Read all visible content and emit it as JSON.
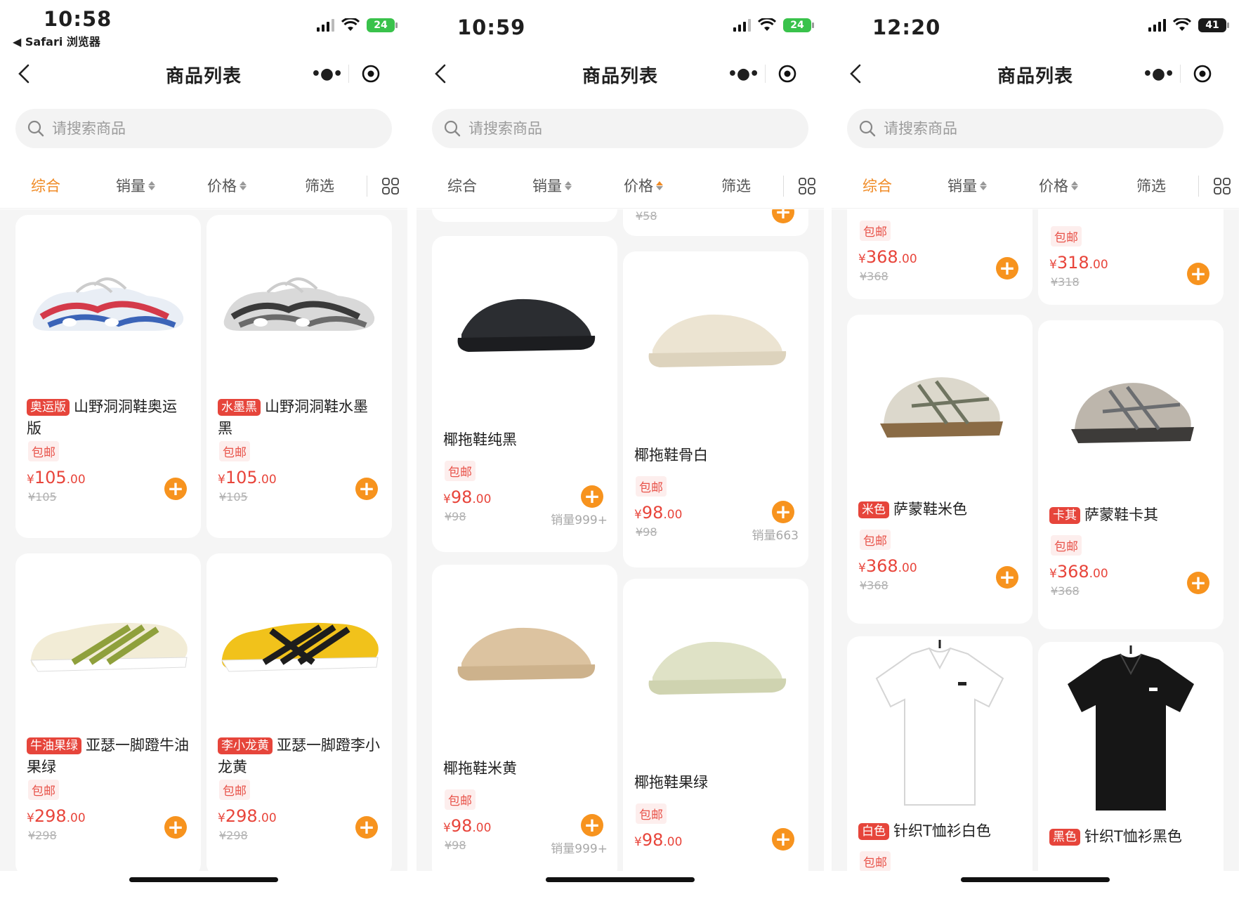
{
  "common": {
    "title": "商品列表",
    "search_placeholder": "请搜索商品",
    "tabs": {
      "overall": "综合",
      "sales": "销量",
      "price": "价格",
      "filter": "筛选"
    },
    "free_shipping": "包邮",
    "currency": "¥",
    "accent_color": "#f08a24",
    "price_color": "#e8453b",
    "tag_color": "#e6453b",
    "add_button_color": "#f7931e"
  },
  "screens": [
    {
      "status": {
        "time": "10:58",
        "back_app": "◀ Safari 浏览器",
        "battery": "24"
      },
      "active_tab": "overall",
      "products": [
        {
          "tag": "奥运版",
          "name": "山野洞洞鞋奥运版",
          "price_int": "105",
          "price_dec": ".00",
          "orig": "¥105",
          "icon": "clog-shoe-multicolor"
        },
        {
          "tag": "水墨黑",
          "name": "山野洞洞鞋水墨黑",
          "price_int": "105",
          "price_dec": ".00",
          "orig": "¥105",
          "icon": "clog-shoe-ink"
        },
        {
          "tag": "牛油果绿",
          "name": "亚瑟一脚蹬牛油果绿",
          "price_int": "298",
          "price_dec": ".00",
          "orig": "¥298",
          "icon": "sneaker-green"
        },
        {
          "tag": "李小龙黄",
          "name": "亚瑟一脚蹬李小龙黄",
          "price_int": "298",
          "price_dec": ".00",
          "orig": "¥298",
          "icon": "sneaker-yellow"
        }
      ]
    },
    {
      "status": {
        "time": "10:59",
        "battery": "24"
      },
      "active_tab": "price",
      "partial_top": {
        "orig": "¥58"
      },
      "products": [
        {
          "name": "椰拖鞋纯黑",
          "price_int": "98",
          "price_dec": ".00",
          "orig": "¥98",
          "sold": "销量999+",
          "icon": "slide-black"
        },
        {
          "name": "椰拖鞋骨白",
          "price_int": "98",
          "price_dec": ".00",
          "orig": "¥98",
          "sold": "销量663",
          "icon": "slide-bone"
        },
        {
          "name": "椰拖鞋米黄",
          "price_int": "98",
          "price_dec": ".00",
          "orig": "¥98",
          "sold": "销量999+",
          "icon": "slide-sand"
        },
        {
          "name": "椰拖鞋果绿",
          "price_int": "98",
          "price_dec": ".00",
          "orig": "¥98",
          "icon": "slide-green"
        }
      ]
    },
    {
      "status": {
        "time": "12:20",
        "battery": "41"
      },
      "active_tab": "overall",
      "partial_top": [
        {
          "price_int": "368",
          "price_dec": ".00",
          "orig": "¥368"
        },
        {
          "price_int": "318",
          "price_dec": ".00",
          "orig": "¥318"
        }
      ],
      "products": [
        {
          "tag": "米色",
          "name": "萨蒙鞋米色",
          "price_int": "368",
          "price_dec": ".00",
          "orig": "¥368",
          "icon": "hiking-shoe-beige"
        },
        {
          "tag": "卡其",
          "name": "萨蒙鞋卡其",
          "price_int": "368",
          "price_dec": ".00",
          "orig": "¥368",
          "icon": "hiking-shoe-khaki"
        },
        {
          "tag": "白色",
          "name": "针织T恤衫白色",
          "icon": "tshirt-white"
        },
        {
          "tag": "黑色",
          "name": "针织T恤衫黑色",
          "icon": "tshirt-black"
        }
      ]
    }
  ]
}
